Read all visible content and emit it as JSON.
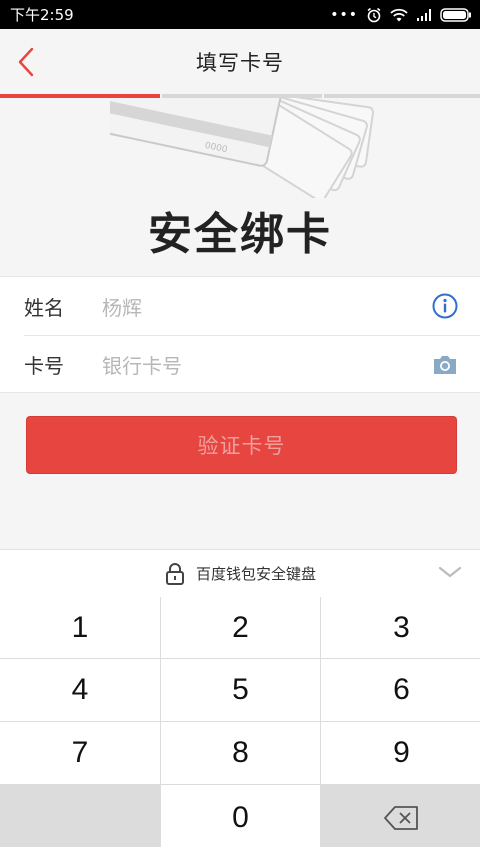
{
  "status_bar": {
    "time": "下午2:59",
    "icons": [
      "more-dots-icon",
      "alarm-icon",
      "wifi-icon",
      "signal-icon",
      "battery-icon"
    ]
  },
  "header": {
    "title": "填写卡号",
    "back_icon": "chevron-left-icon"
  },
  "progress": {
    "total_steps": 3,
    "current_step": 1,
    "active_color": "#e64540",
    "inactive_color": "#d7d7d7"
  },
  "hero": {
    "headline": "安全绑卡",
    "card_text": "0000"
  },
  "form": {
    "name": {
      "label": "姓名",
      "value": "杨辉",
      "icon": "info-icon"
    },
    "card_number": {
      "label": "卡号",
      "placeholder": "银行卡号",
      "icon": "camera-icon"
    }
  },
  "verify_button": {
    "label": "验证卡号",
    "color": "#e64540"
  },
  "keyboard": {
    "caption": "百度钱包安全键盘",
    "lock_icon": "lock-icon",
    "collapse_icon": "chevron-down-icon",
    "keys": [
      "1",
      "2",
      "3",
      "4",
      "5",
      "6",
      "7",
      "8",
      "9",
      "0"
    ],
    "delete_icon": "backspace-icon"
  }
}
